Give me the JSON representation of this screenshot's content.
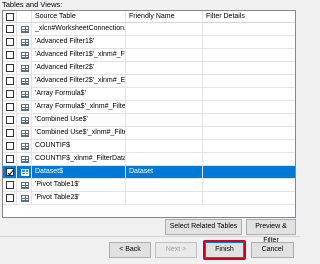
{
  "section_label": "Tables and Views:",
  "columns": {
    "source": "Source Table",
    "friendly": "Friendly Name",
    "filter": "Filter Details"
  },
  "rows": [
    {
      "checked": false,
      "source": "_xlcn#WorksheetConnection...",
      "friendly": "",
      "filter": "",
      "selected": false
    },
    {
      "checked": false,
      "source": "'Advanced Filter1$'",
      "friendly": "",
      "filter": "",
      "selected": false
    },
    {
      "checked": false,
      "source": "'Advanced Filter1$'_xlnm#_Fi...",
      "friendly": "",
      "filter": "",
      "selected": false
    },
    {
      "checked": false,
      "source": "'Advanced Filter2$'",
      "friendly": "",
      "filter": "",
      "selected": false
    },
    {
      "checked": false,
      "source": "'Advanced Filter2$'_xlnm#_Ex...",
      "friendly": "",
      "filter": "",
      "selected": false
    },
    {
      "checked": false,
      "source": "'Array Formula$'",
      "friendly": "",
      "filter": "",
      "selected": false
    },
    {
      "checked": false,
      "source": "'Array Formula$'_xlnm#_Filter...",
      "friendly": "",
      "filter": "",
      "selected": false
    },
    {
      "checked": false,
      "source": "'Combined Use$'",
      "friendly": "",
      "filter": "",
      "selected": false
    },
    {
      "checked": false,
      "source": "'Combined Use$'_xlnm#_Filte...",
      "friendly": "",
      "filter": "",
      "selected": false
    },
    {
      "checked": false,
      "source": "COUNTIF$",
      "friendly": "",
      "filter": "",
      "selected": false
    },
    {
      "checked": false,
      "source": "COUNTIF$_xlnm#_FilterData...",
      "friendly": "",
      "filter": "",
      "selected": false
    },
    {
      "checked": true,
      "source": "Dataset$",
      "friendly": "Dataset",
      "filter": "",
      "selected": true
    },
    {
      "checked": false,
      "source": "'Pivot Table1$'",
      "friendly": "",
      "filter": "",
      "selected": false
    },
    {
      "checked": false,
      "source": "'Pivot Table2$'",
      "friendly": "",
      "filter": "",
      "selected": false
    }
  ],
  "buttons": {
    "select_related": "Select Related Tables",
    "preview_filter": "Preview & Filter",
    "back": "< Back",
    "next": "Next >",
    "finish": "Finish",
    "cancel": "Cancel"
  },
  "colors": {
    "selection": "#0078d7",
    "highlight_border": "#d0021b"
  }
}
